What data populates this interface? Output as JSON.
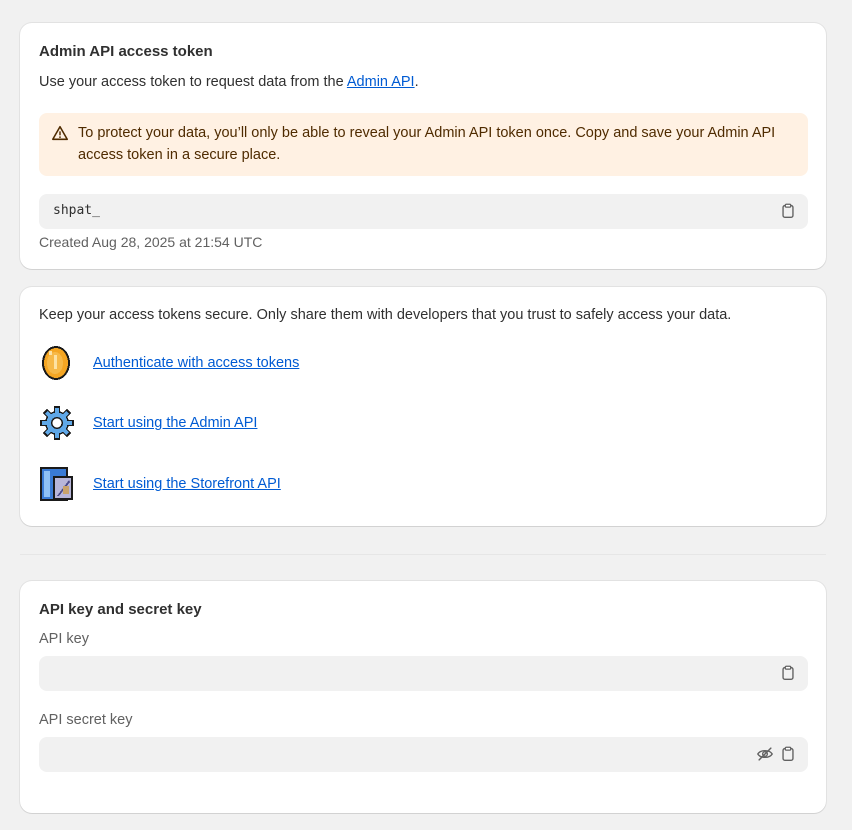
{
  "token_card": {
    "title": "Admin API access token",
    "intro_prefix": "Use your access token to request data from the ",
    "intro_link": "Admin API",
    "intro_suffix": ".",
    "warning": "To protect your data, you’ll only be able to reveal your Admin API token once. Copy and save your Admin API access token in a secure place.",
    "token_value": "shpat_",
    "created": "Created Aug 28, 2025 at 21:54 UTC",
    "copy_icon": "clipboard-icon",
    "warning_icon": "alert-triangle-icon"
  },
  "resources_card": {
    "intro": "Keep your access tokens secure. Only share them with developers that you trust to safely access your data.",
    "links": [
      {
        "label": "Authenticate with access tokens",
        "icon": "coin-icon"
      },
      {
        "label": "Start using the Admin API",
        "icon": "gear-icon"
      },
      {
        "label": "Start using the Storefront API",
        "icon": "storefront-icon"
      }
    ]
  },
  "keys_card": {
    "title": "API key and secret key",
    "api_key_label": "API key",
    "api_key_value": "",
    "secret_label": "API secret key",
    "secret_value": "",
    "hide_icon": "eye-off-icon",
    "copy_icon": "clipboard-icon"
  },
  "colors": {
    "link": "#005bd3",
    "warning_bg": "#fff1e3",
    "warning_text": "#4f2b00",
    "page_bg": "#f1f1f1",
    "field_bg": "#f1f1f1"
  }
}
